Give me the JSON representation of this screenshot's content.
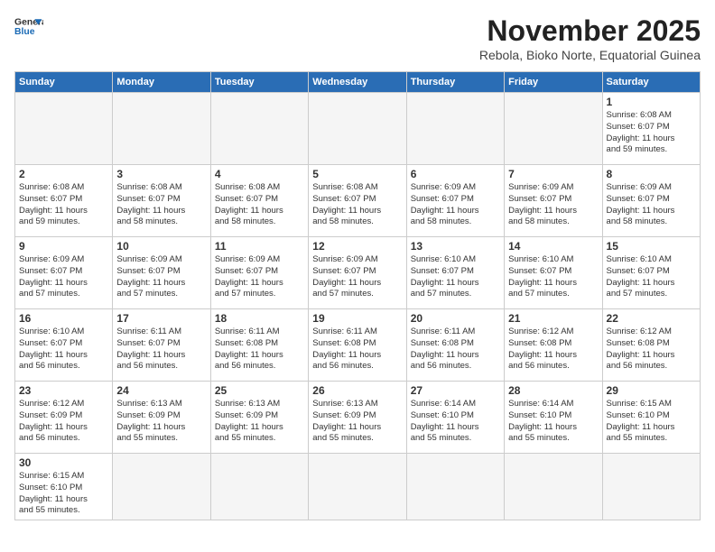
{
  "header": {
    "logo_line1": "General",
    "logo_line2": "Blue",
    "month_title": "November 2025",
    "subtitle": "Rebola, Bioko Norte, Equatorial Guinea"
  },
  "weekdays": [
    "Sunday",
    "Monday",
    "Tuesday",
    "Wednesday",
    "Thursday",
    "Friday",
    "Saturday"
  ],
  "weeks": [
    [
      {
        "day": "",
        "info": ""
      },
      {
        "day": "",
        "info": ""
      },
      {
        "day": "",
        "info": ""
      },
      {
        "day": "",
        "info": ""
      },
      {
        "day": "",
        "info": ""
      },
      {
        "day": "",
        "info": ""
      },
      {
        "day": "1",
        "info": "Sunrise: 6:08 AM\nSunset: 6:07 PM\nDaylight: 11 hours\nand 59 minutes."
      }
    ],
    [
      {
        "day": "2",
        "info": "Sunrise: 6:08 AM\nSunset: 6:07 PM\nDaylight: 11 hours\nand 59 minutes."
      },
      {
        "day": "3",
        "info": "Sunrise: 6:08 AM\nSunset: 6:07 PM\nDaylight: 11 hours\nand 58 minutes."
      },
      {
        "day": "4",
        "info": "Sunrise: 6:08 AM\nSunset: 6:07 PM\nDaylight: 11 hours\nand 58 minutes."
      },
      {
        "day": "5",
        "info": "Sunrise: 6:08 AM\nSunset: 6:07 PM\nDaylight: 11 hours\nand 58 minutes."
      },
      {
        "day": "6",
        "info": "Sunrise: 6:09 AM\nSunset: 6:07 PM\nDaylight: 11 hours\nand 58 minutes."
      },
      {
        "day": "7",
        "info": "Sunrise: 6:09 AM\nSunset: 6:07 PM\nDaylight: 11 hours\nand 58 minutes."
      },
      {
        "day": "8",
        "info": "Sunrise: 6:09 AM\nSunset: 6:07 PM\nDaylight: 11 hours\nand 58 minutes."
      }
    ],
    [
      {
        "day": "9",
        "info": "Sunrise: 6:09 AM\nSunset: 6:07 PM\nDaylight: 11 hours\nand 57 minutes."
      },
      {
        "day": "10",
        "info": "Sunrise: 6:09 AM\nSunset: 6:07 PM\nDaylight: 11 hours\nand 57 minutes."
      },
      {
        "day": "11",
        "info": "Sunrise: 6:09 AM\nSunset: 6:07 PM\nDaylight: 11 hours\nand 57 minutes."
      },
      {
        "day": "12",
        "info": "Sunrise: 6:09 AM\nSunset: 6:07 PM\nDaylight: 11 hours\nand 57 minutes."
      },
      {
        "day": "13",
        "info": "Sunrise: 6:10 AM\nSunset: 6:07 PM\nDaylight: 11 hours\nand 57 minutes."
      },
      {
        "day": "14",
        "info": "Sunrise: 6:10 AM\nSunset: 6:07 PM\nDaylight: 11 hours\nand 57 minutes."
      },
      {
        "day": "15",
        "info": "Sunrise: 6:10 AM\nSunset: 6:07 PM\nDaylight: 11 hours\nand 57 minutes."
      }
    ],
    [
      {
        "day": "16",
        "info": "Sunrise: 6:10 AM\nSunset: 6:07 PM\nDaylight: 11 hours\nand 56 minutes."
      },
      {
        "day": "17",
        "info": "Sunrise: 6:11 AM\nSunset: 6:07 PM\nDaylight: 11 hours\nand 56 minutes."
      },
      {
        "day": "18",
        "info": "Sunrise: 6:11 AM\nSunset: 6:08 PM\nDaylight: 11 hours\nand 56 minutes."
      },
      {
        "day": "19",
        "info": "Sunrise: 6:11 AM\nSunset: 6:08 PM\nDaylight: 11 hours\nand 56 minutes."
      },
      {
        "day": "20",
        "info": "Sunrise: 6:11 AM\nSunset: 6:08 PM\nDaylight: 11 hours\nand 56 minutes."
      },
      {
        "day": "21",
        "info": "Sunrise: 6:12 AM\nSunset: 6:08 PM\nDaylight: 11 hours\nand 56 minutes."
      },
      {
        "day": "22",
        "info": "Sunrise: 6:12 AM\nSunset: 6:08 PM\nDaylight: 11 hours\nand 56 minutes."
      }
    ],
    [
      {
        "day": "23",
        "info": "Sunrise: 6:12 AM\nSunset: 6:09 PM\nDaylight: 11 hours\nand 56 minutes."
      },
      {
        "day": "24",
        "info": "Sunrise: 6:13 AM\nSunset: 6:09 PM\nDaylight: 11 hours\nand 55 minutes."
      },
      {
        "day": "25",
        "info": "Sunrise: 6:13 AM\nSunset: 6:09 PM\nDaylight: 11 hours\nand 55 minutes."
      },
      {
        "day": "26",
        "info": "Sunrise: 6:13 AM\nSunset: 6:09 PM\nDaylight: 11 hours\nand 55 minutes."
      },
      {
        "day": "27",
        "info": "Sunrise: 6:14 AM\nSunset: 6:10 PM\nDaylight: 11 hours\nand 55 minutes."
      },
      {
        "day": "28",
        "info": "Sunrise: 6:14 AM\nSunset: 6:10 PM\nDaylight: 11 hours\nand 55 minutes."
      },
      {
        "day": "29",
        "info": "Sunrise: 6:15 AM\nSunset: 6:10 PM\nDaylight: 11 hours\nand 55 minutes."
      }
    ],
    [
      {
        "day": "30",
        "info": "Sunrise: 6:15 AM\nSunset: 6:10 PM\nDaylight: 11 hours\nand 55 minutes."
      },
      {
        "day": "",
        "info": ""
      },
      {
        "day": "",
        "info": ""
      },
      {
        "day": "",
        "info": ""
      },
      {
        "day": "",
        "info": ""
      },
      {
        "day": "",
        "info": ""
      },
      {
        "day": "",
        "info": ""
      }
    ]
  ]
}
